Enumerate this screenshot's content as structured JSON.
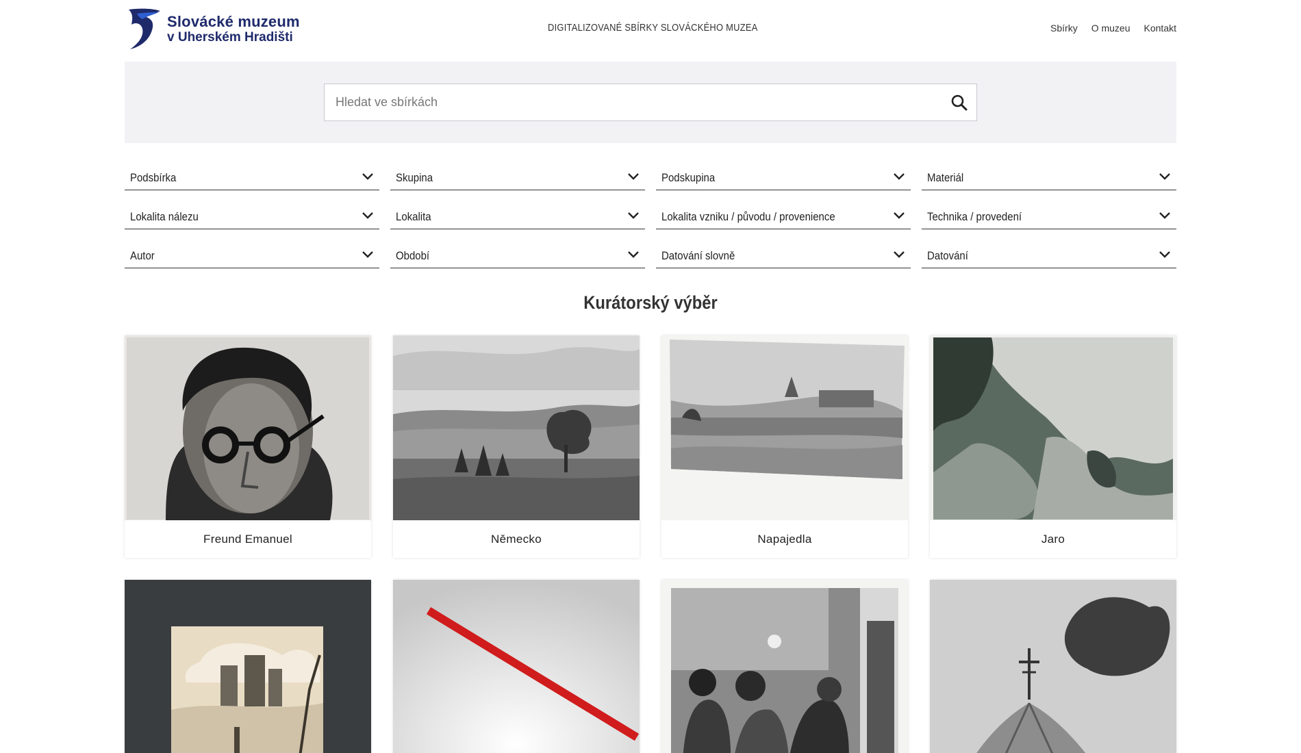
{
  "header": {
    "logo_line1": "Slovácké muzeum",
    "logo_line2": "v Uherském Hradišti",
    "tagline": "DIGITALIZOVANÉ SBÍRKY SLOVÁCKÉHO MUZEA",
    "nav": [
      "Sbírky",
      "O muzeu",
      "Kontakt"
    ]
  },
  "search": {
    "placeholder": "Hledat ve sbírkách"
  },
  "filters": [
    "Podsbírka",
    "Skupina",
    "Podskupina",
    "Materiál",
    "Lokalita nálezu",
    "Lokalita",
    "Lokalita vzniku / původu / provenience",
    "Technika / provedení",
    "Autor",
    "Období",
    "Datování slovně",
    "Datování"
  ],
  "curated": {
    "title": "Kurátorský výběr",
    "items": [
      "Freund Emanuel",
      "Německo",
      "Napajedla",
      "Jaro"
    ]
  },
  "colors": {
    "brand": "#1f2a6b",
    "logo_blue": "#2f5fd0",
    "band": "#f2f2f5",
    "ribbon_red": "#d01c1c"
  }
}
